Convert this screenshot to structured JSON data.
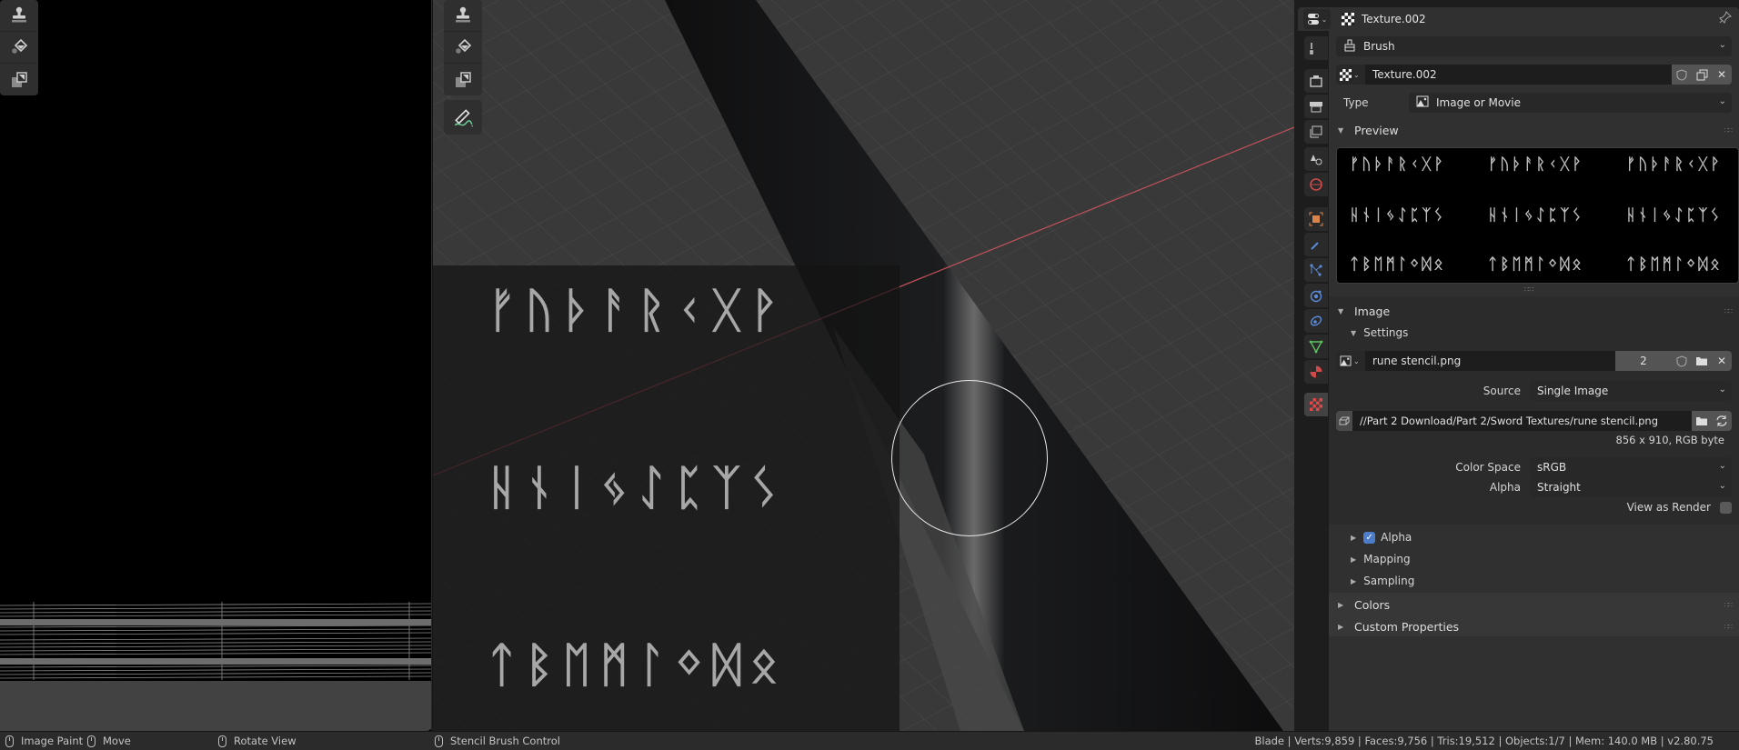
{
  "left_editor": {
    "tools": [
      {
        "name": "clone-stamp",
        "icon": "stamp-icon"
      },
      {
        "name": "fill",
        "icon": "paint-bucket-icon"
      },
      {
        "name": "mask",
        "icon": "mask-icon"
      }
    ]
  },
  "viewport": {
    "tools": [
      {
        "name": "clone-stamp",
        "icon": "stamp-icon"
      },
      {
        "name": "fill",
        "icon": "paint-bucket-icon"
      },
      {
        "name": "mask",
        "icon": "mask-icon"
      },
      {
        "name": "annotate",
        "icon": "annotate-pencil-icon"
      }
    ],
    "stencil_rows": [
      "ᚠᚢᚦᚨᚱᚲᚷᚹ",
      "ᚺᚾᛁᛃᛇᛈᛉᛊ",
      "ᛏᛒᛖᛗᛚᛜᛞᛟ"
    ],
    "axis_color": "#c5525d"
  },
  "properties": {
    "header": {
      "context_title": "Texture.002"
    },
    "brush_selector": {
      "value": "Brush"
    },
    "texture_block": {
      "name": "Texture.002"
    },
    "type": {
      "label": "Type",
      "value": "Image or Movie"
    },
    "preview_panel": {
      "label": "Preview"
    },
    "preview_rows": [
      "ᚠᚢᚦᚨᚱᚲᚷᚹ",
      "ᚺᚾᛁᛃᛇᛈᛉᛊ",
      "ᛏᛒᛖᛗᛚᛜᛞᛟ"
    ],
    "image_panel": {
      "label": "Image",
      "settings_label": "Settings",
      "image_name": "rune stencil.png",
      "users": "2",
      "source": {
        "label": "Source",
        "value": "Single Image"
      },
      "filepath": "//Part 2 Download/Part 2/Sword Textures/rune stencil.png",
      "info": "856 x 910,  RGB byte",
      "color_space": {
        "label": "Color Space",
        "value": "sRGB"
      },
      "alpha_mode": {
        "label": "Alpha",
        "value": "Straight"
      },
      "view_as_render": {
        "label": "View as Render",
        "checked": false
      }
    },
    "subpanels": [
      {
        "label": "Alpha",
        "checkbox": true
      },
      {
        "label": "Mapping"
      },
      {
        "label": "Sampling"
      }
    ],
    "collapsed_panels": [
      {
        "label": "Colors"
      },
      {
        "label": "Custom Properties"
      }
    ],
    "tabs": [
      {
        "name": "tool",
        "color": "#c8c8c8"
      },
      {
        "name": "render",
        "color": "#c8c8c8"
      },
      {
        "name": "output",
        "color": "#c8c8c8"
      },
      {
        "name": "view-layer",
        "color": "#c8c8c8"
      },
      {
        "name": "scene",
        "color": "#c8c8c8"
      },
      {
        "name": "world",
        "color": "#d04a4a"
      },
      {
        "name": "object",
        "color": "#d8844a"
      },
      {
        "name": "modifiers",
        "color": "#5a8ad8"
      },
      {
        "name": "particles",
        "color": "#5a8ad8"
      },
      {
        "name": "physics",
        "color": "#5a8ad8"
      },
      {
        "name": "constraints",
        "color": "#5a8ad8"
      },
      {
        "name": "object-data",
        "color": "#5ec35e"
      },
      {
        "name": "material",
        "color": "#d04a4a"
      },
      {
        "name": "texture",
        "color": "#e04848",
        "active": true
      }
    ]
  },
  "statusbar": {
    "items": [
      {
        "label": "Image Paint"
      },
      {
        "label": "Move"
      },
      {
        "label": "Rotate View"
      },
      {
        "label": "Stencil Brush Control"
      }
    ],
    "stats": "Blade | Verts:9,859 | Faces:9,756 | Tris:19,512 | Objects:1/7 | Mem: 140.0 MB | v2.80.75"
  }
}
